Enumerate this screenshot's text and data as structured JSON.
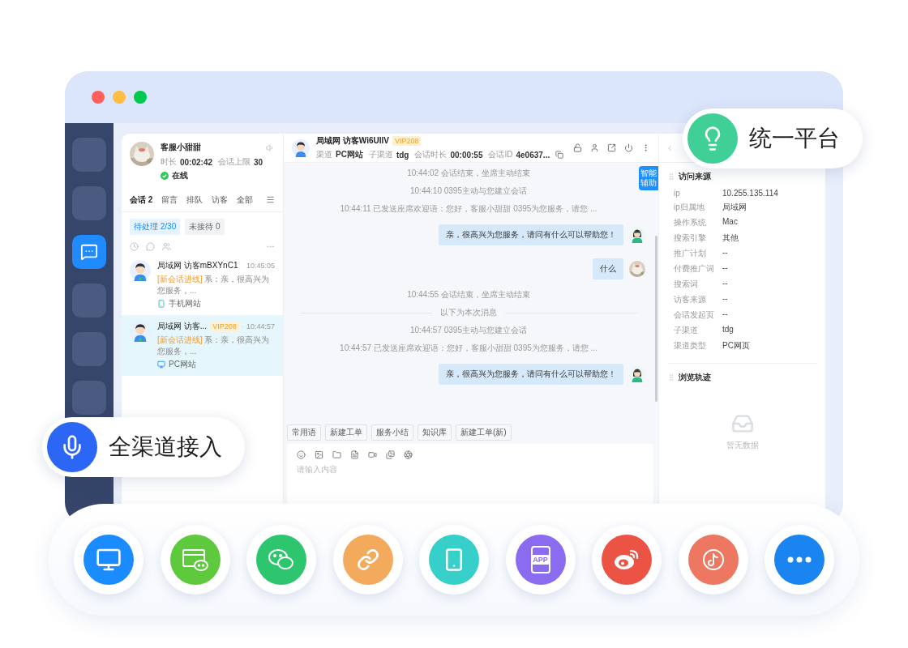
{
  "sidebar": {
    "items": [
      {
        "selected": false
      },
      {
        "selected": false
      },
      {
        "selected": true
      },
      {
        "selected": false
      },
      {
        "selected": false
      },
      {
        "selected": false
      }
    ]
  },
  "agent": {
    "name": "客服小甜甜",
    "duration_label": "时长",
    "duration": "00:02:42",
    "limit_label": "会话上限",
    "limit": "30",
    "status": "在线",
    "online": true
  },
  "session_tabs": [
    {
      "label": "会话 2",
      "selected": true
    },
    {
      "label": "留言",
      "selected": false
    },
    {
      "label": "排队",
      "selected": false
    },
    {
      "label": "访客",
      "selected": false
    },
    {
      "label": "全部",
      "selected": false
    }
  ],
  "filters": [
    {
      "label": "待处理 2/30",
      "selected": true
    },
    {
      "label": "未接待 0",
      "selected": false
    }
  ],
  "conversations": [
    {
      "title": "局域网 访客mBXYnC1",
      "time": "10:45:05",
      "tag": "[新会话进线]",
      "preview": "系：亲，很高兴为您服务，...",
      "source": {
        "kind": "mobile",
        "label": "手机网站"
      },
      "selected": false
    },
    {
      "title": "局域网 访客...",
      "vip": "VIP208",
      "time": "10:44:57",
      "tag": "[新会话进线]",
      "preview": "系：亲，很高兴为您服务，...",
      "source": {
        "kind": "pc",
        "label": "PC网站"
      },
      "selected": true
    }
  ],
  "chat": {
    "title": "局域网 访客Wi6UIlV",
    "vip": "VIP208",
    "meta": [
      {
        "label": "渠道",
        "value": "PC网站"
      },
      {
        "label": "子渠道",
        "value": "tdg"
      },
      {
        "label": "会话时长",
        "value": "00:00:55"
      },
      {
        "label": "会话ID",
        "value": "4e0637..."
      }
    ],
    "assist": "智能辅助",
    "messages": [
      {
        "kind": "system",
        "text": "10:44:02 会话结束，坐席主动结束"
      },
      {
        "kind": "system",
        "text": "10:44:10 0395主动与您建立会话"
      },
      {
        "kind": "system",
        "text": "10:44:11 已发送座席欢迎语：您好，客服小甜甜 0395为您服务，请您 ..."
      },
      {
        "kind": "bot",
        "text": "亲，很高兴为您服务，请问有什么可以帮助您！"
      },
      {
        "kind": "agent",
        "text": "什么"
      },
      {
        "kind": "system",
        "text": "10:44:55 会话结束，坐席主动结束"
      },
      {
        "kind": "divider",
        "text": "以下为本次消息"
      },
      {
        "kind": "system",
        "text": "10:44:57 0395主动与您建立会话"
      },
      {
        "kind": "system",
        "text": "10:44:57 已发送座席欢迎语：您好，客服小甜甜 0395为您服务，请您 ..."
      },
      {
        "kind": "bot",
        "text": "亲，很高兴为您服务，请问有什么可以帮助您！"
      }
    ],
    "quick_actions": [
      "常用语",
      "新建工单",
      "服务小结",
      "知识库",
      "新建工单(新)"
    ],
    "composer": {
      "placeholder": "请输入内容"
    }
  },
  "visitor_info": {
    "title": "访问来源",
    "rows": [
      {
        "label": "ip",
        "value": "10.255.135.114"
      },
      {
        "label": "ip归属地",
        "value": "局域网"
      },
      {
        "label": "操作系统",
        "value": "Mac"
      },
      {
        "label": "搜索引擎",
        "value": "其他"
      },
      {
        "label": "推广计划",
        "value": "--"
      },
      {
        "label": "付费推广词",
        "value": "--"
      },
      {
        "label": "搜索词",
        "value": "--"
      },
      {
        "label": "访客来源",
        "value": "--"
      },
      {
        "label": "会话发起页",
        "value": "--"
      },
      {
        "label": "子渠道",
        "value": "tdg"
      },
      {
        "label": "渠道类型",
        "value": "PC网页"
      }
    ]
  },
  "trail": {
    "title": "浏览轨迹",
    "empty": "暂无数据"
  },
  "callouts": [
    {
      "kind": "platform",
      "label": "统一平台"
    },
    {
      "kind": "channels",
      "label": "全渠道接入"
    }
  ],
  "channels": [
    {
      "kind": "pc",
      "color": "#1a8cff"
    },
    {
      "kind": "web",
      "color": "#5fc93e"
    },
    {
      "kind": "chat",
      "color": "#2ec56f"
    },
    {
      "kind": "link",
      "color": "#f3aa5c"
    },
    {
      "kind": "mobile",
      "color": "#37cfca"
    },
    {
      "kind": "app",
      "color": "#8b6cf1",
      "label": "APP"
    },
    {
      "kind": "weibo",
      "color": "#eb5445"
    },
    {
      "kind": "music",
      "color": "#ee7762"
    },
    {
      "kind": "more",
      "color": "#1a84f0"
    }
  ]
}
